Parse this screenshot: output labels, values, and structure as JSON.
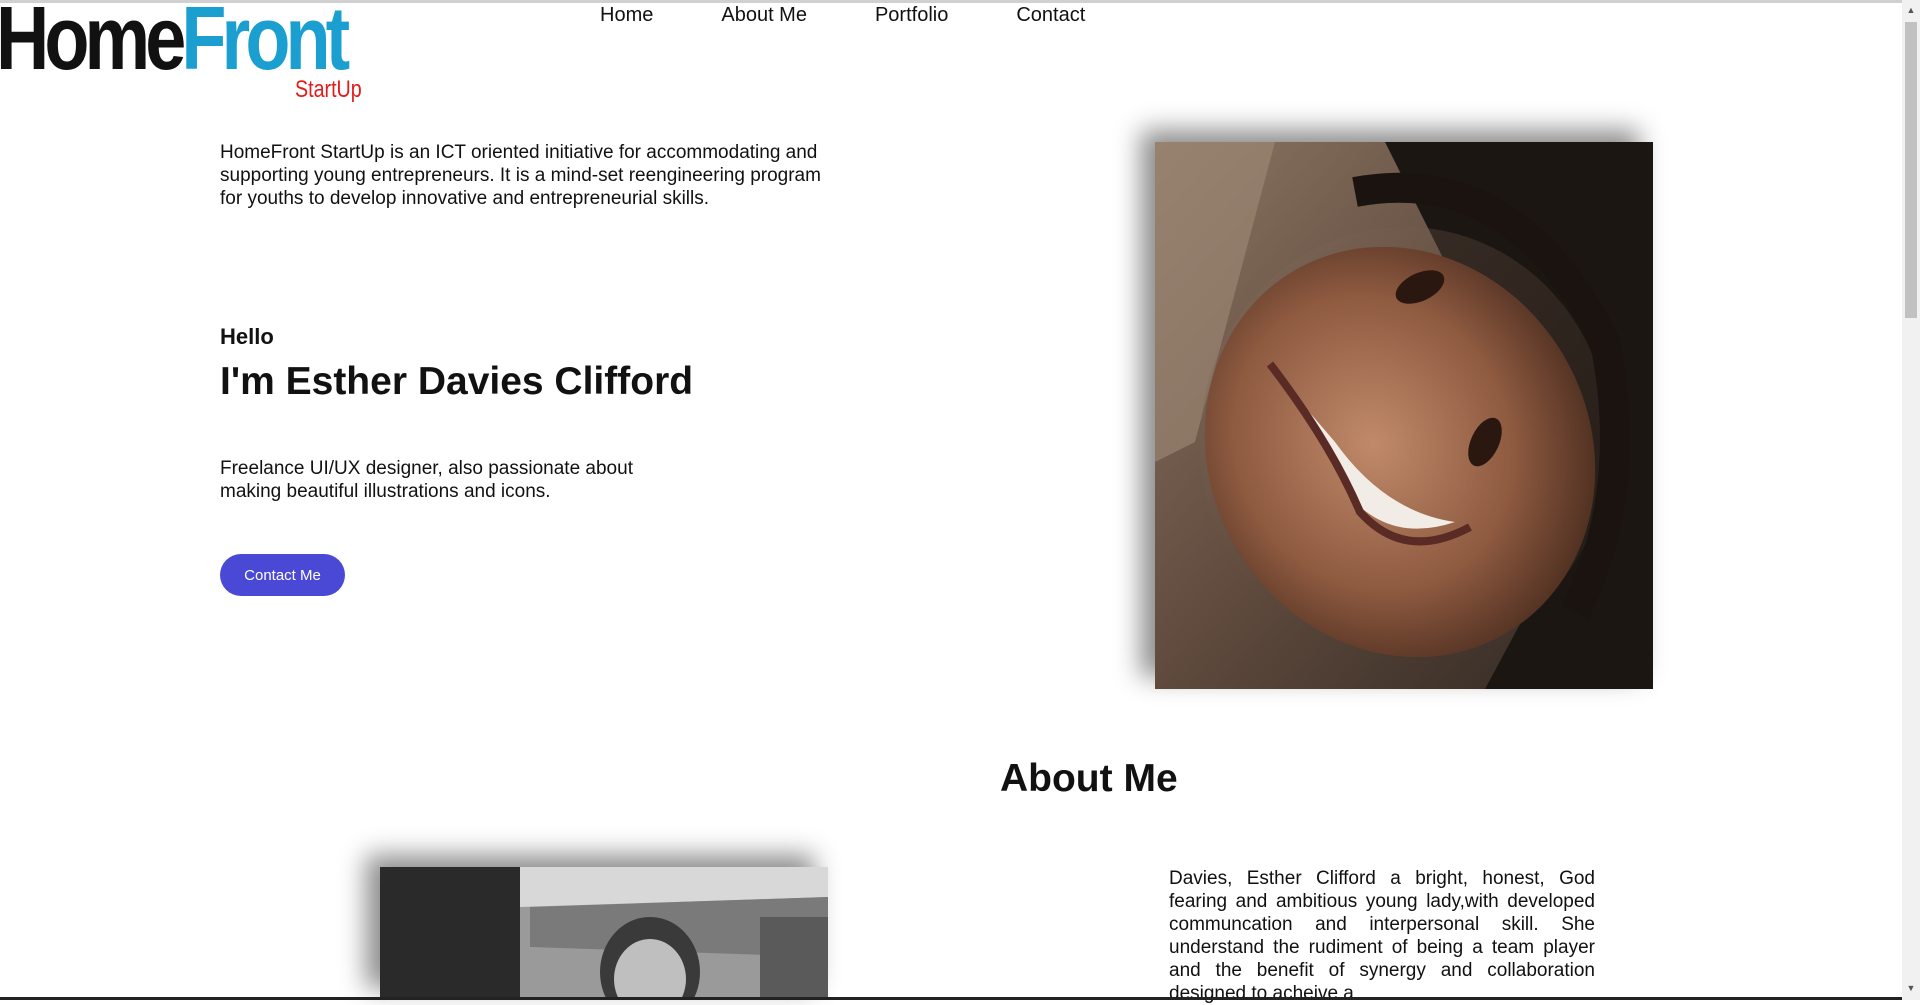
{
  "logo": {
    "home": "Home",
    "front": "Front",
    "startup": "StartUp"
  },
  "nav": {
    "items": [
      "Home",
      "About Me",
      "Portfolio",
      "Contact"
    ]
  },
  "hero": {
    "intro": "HomeFront StartUp is an ICT oriented initiative for accommodating and supporting young entrepreneurs. It is a mind-set reengineering program for youths to develop innovative and entrepreneurial skills.",
    "greeting": "Hello",
    "name": "I'm Esther Davies Clifford",
    "tagline": "Freelance UI/UX designer, also passionate about making beautiful illustrations and icons.",
    "button_label": "Contact Me"
  },
  "about": {
    "title": "About Me",
    "text": "Davies, Esther Clifford a bright, honest, God fearing and ambitious young lady,with developed communcation and interpersonal skill. She understand the rudiment of being a team player and the benefit of synergy and collaboration designed to acheive a"
  },
  "colors": {
    "accent": "#4a49d6",
    "logo_blue": "#1a9fd0",
    "logo_red": "#e21b1b"
  },
  "icons": {
    "scroll_up": "triangle-up-icon",
    "scroll_down": "triangle-down-icon"
  }
}
